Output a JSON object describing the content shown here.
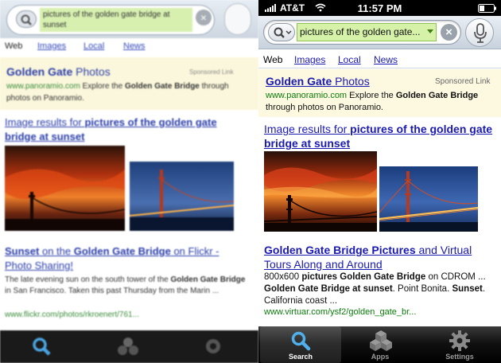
{
  "left_photo": {
    "search": {
      "query": "pictures of the golden gate bridge at sunset"
    },
    "tabs": [
      "Web",
      "Images",
      "Local",
      "News"
    ],
    "ad": {
      "title_bold": "Golden Gate",
      "title_rest": "Photos",
      "sponsored": "Sponsored Link",
      "url": "www.panoramio.com",
      "desc_pre": "Explore the",
      "desc_bold": "Golden Gate Bridge",
      "desc_post": "through photos on Panoramio."
    },
    "image_results": {
      "prefix": "Image results for",
      "query": "pictures of the golden gate bridge at sunset"
    },
    "result": {
      "title_pre": "Sunset",
      "title_mid1": "on the",
      "title_bold": "Golden Gate Bridge",
      "title_post": "on Flickr - Photo Sharing!",
      "snippet_a": "The late evening sun on the south tower of the",
      "snippet_bold": "Golden Gate Bridge",
      "snippet_b": "in San Francisco. Taken this past Thursday from the Marin ...",
      "url": "www.flickr.com/photos/rkroenert/761..."
    }
  },
  "right_screen": {
    "status": {
      "carrier": "AT&T",
      "time": "11:57 PM"
    },
    "search": {
      "query": "pictures of the golden gate..."
    },
    "tabs": [
      "Web",
      "Images",
      "Local",
      "News"
    ],
    "ad": {
      "title_bold": "Golden Gate",
      "title_rest": "Photos",
      "sponsored": "Sponsored Link",
      "url": "www.panoramio.com",
      "desc_pre": "Explore the",
      "desc_bold": "Golden Gate Bridge",
      "desc_post": "through photos on Panoramio."
    },
    "image_results": {
      "prefix": "Image results for",
      "query": "pictures of the golden gate bridge at sunset"
    },
    "result": {
      "title_bold": "Golden Gate Bridge Pictures",
      "title_rest": "and Virtual Tours Along and Around",
      "snippet_1": "800x600",
      "snippet_2": "pictures Golden Gate Bridge",
      "snippet_3": "on CDROM ...",
      "snippet_4": "Golden Gate Bridge at sunset",
      "snippet_5": ". Point Bonita.",
      "snippet_6": "Sunset",
      "snippet_7": ". California coast ...",
      "url": "www.virtuar.com/ysf2/golden_gate_br..."
    },
    "bottom_tabs": [
      {
        "label": "Search",
        "icon": "magnifier-icon",
        "active": true
      },
      {
        "label": "Apps",
        "icon": "cubes-icon",
        "active": false
      },
      {
        "label": "Settings",
        "icon": "gear-icon",
        "active": false
      }
    ]
  },
  "colors": {
    "link": "#1a1ab0",
    "url_green": "#0a7d0a",
    "ad_background": "#fdf9e1",
    "query_highlight": "#d6f2a9"
  }
}
